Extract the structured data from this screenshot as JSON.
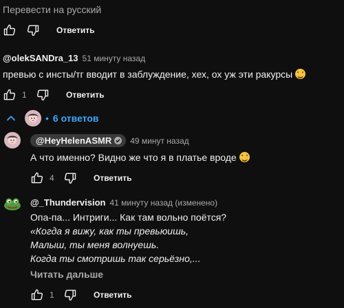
{
  "translate_label": "Перевести на русский",
  "reply_label": "Ответить",
  "comment1": {
    "author": "@olekSANDra_13",
    "time": "51 минуту назад",
    "text": "превью с инсты/тг вводит в заблуждение, хех, ох уж эти ракурсы",
    "likes": "1"
  },
  "replies_toggle": {
    "label": "6 ответов"
  },
  "reply1": {
    "author": "@HeyHelenASMR",
    "time": "49 минут назад",
    "text": "А что именно? Видно же что я в платье вроде",
    "likes": "4"
  },
  "reply2": {
    "author": "@_Thundervision",
    "time": "41 минуту назад (изменено)",
    "line1": "Опа-па... Интриги... Как там вольно поётся?",
    "line2": "«Когда я вижу, как ты превьюишь,",
    "line3": "Малыш, ты меня волнуешь.",
    "line4": "Когда ты смотришь так серьёзно,...",
    "read_more": "Читать дальше",
    "likes": "1"
  },
  "icons": {
    "like": "thumbs-up-icon",
    "dislike": "thumbs-down-icon",
    "chevron": "chevron-down-icon",
    "verified": "check-icon",
    "emoji": "grinning-emoji-icon"
  },
  "colors": {
    "background": "#0f0f0f",
    "link": "#3ea6ff",
    "muted": "#aaaaaa"
  }
}
